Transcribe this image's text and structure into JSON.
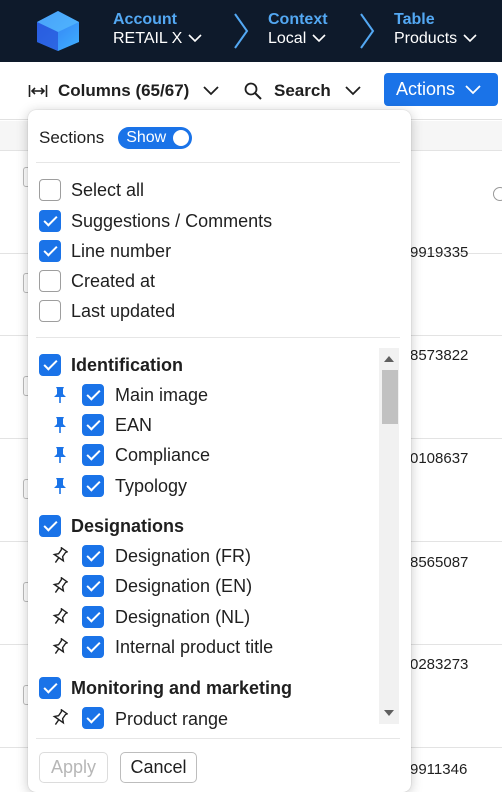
{
  "breadcrumbs": [
    {
      "key": "Account",
      "value": "RETAIL X"
    },
    {
      "key": "Context",
      "value": "Local"
    },
    {
      "key": "Table",
      "value": "Products"
    }
  ],
  "toolbar": {
    "columns_label": "Columns (65/67)",
    "search_label": "Search",
    "actions_label": "Actions"
  },
  "table": {
    "row_values": [
      "9919335",
      "8573822",
      "0108637",
      "8565087",
      "0283273",
      "9911346"
    ]
  },
  "panel": {
    "sections_label": "Sections",
    "toggle_label": "Show",
    "toggle_on": true,
    "general": [
      {
        "label": "Select all",
        "checked": false
      },
      {
        "label": "Suggestions / Comments",
        "checked": true
      },
      {
        "label": "Line number",
        "checked": true
      },
      {
        "label": "Created at",
        "checked": false
      },
      {
        "label": "Last updated",
        "checked": false
      }
    ],
    "groups": [
      {
        "name": "Identification",
        "checked": true,
        "items": [
          {
            "label": "Main image",
            "checked": true,
            "pinned": true
          },
          {
            "label": "EAN",
            "checked": true,
            "pinned": true
          },
          {
            "label": "Compliance",
            "checked": true,
            "pinned": true
          },
          {
            "label": "Typology",
            "checked": true,
            "pinned": true
          }
        ]
      },
      {
        "name": "Designations",
        "checked": true,
        "items": [
          {
            "label": "Designation (FR)",
            "checked": true,
            "pinned": false
          },
          {
            "label": "Designation (EN)",
            "checked": true,
            "pinned": false
          },
          {
            "label": "Designation (NL)",
            "checked": true,
            "pinned": false
          },
          {
            "label": "Internal product title",
            "checked": true,
            "pinned": false
          }
        ]
      },
      {
        "name": "Monitoring and marketing",
        "checked": true,
        "items": [
          {
            "label": "Product range",
            "checked": true,
            "pinned": false
          }
        ]
      }
    ],
    "apply_label": "Apply",
    "cancel_label": "Cancel"
  },
  "colors": {
    "nav_bg": "#0e1a2b",
    "accent": "#1a73e8",
    "breadcrumb_key": "#53a8f3",
    "pin_filled": "#1a73e8"
  }
}
